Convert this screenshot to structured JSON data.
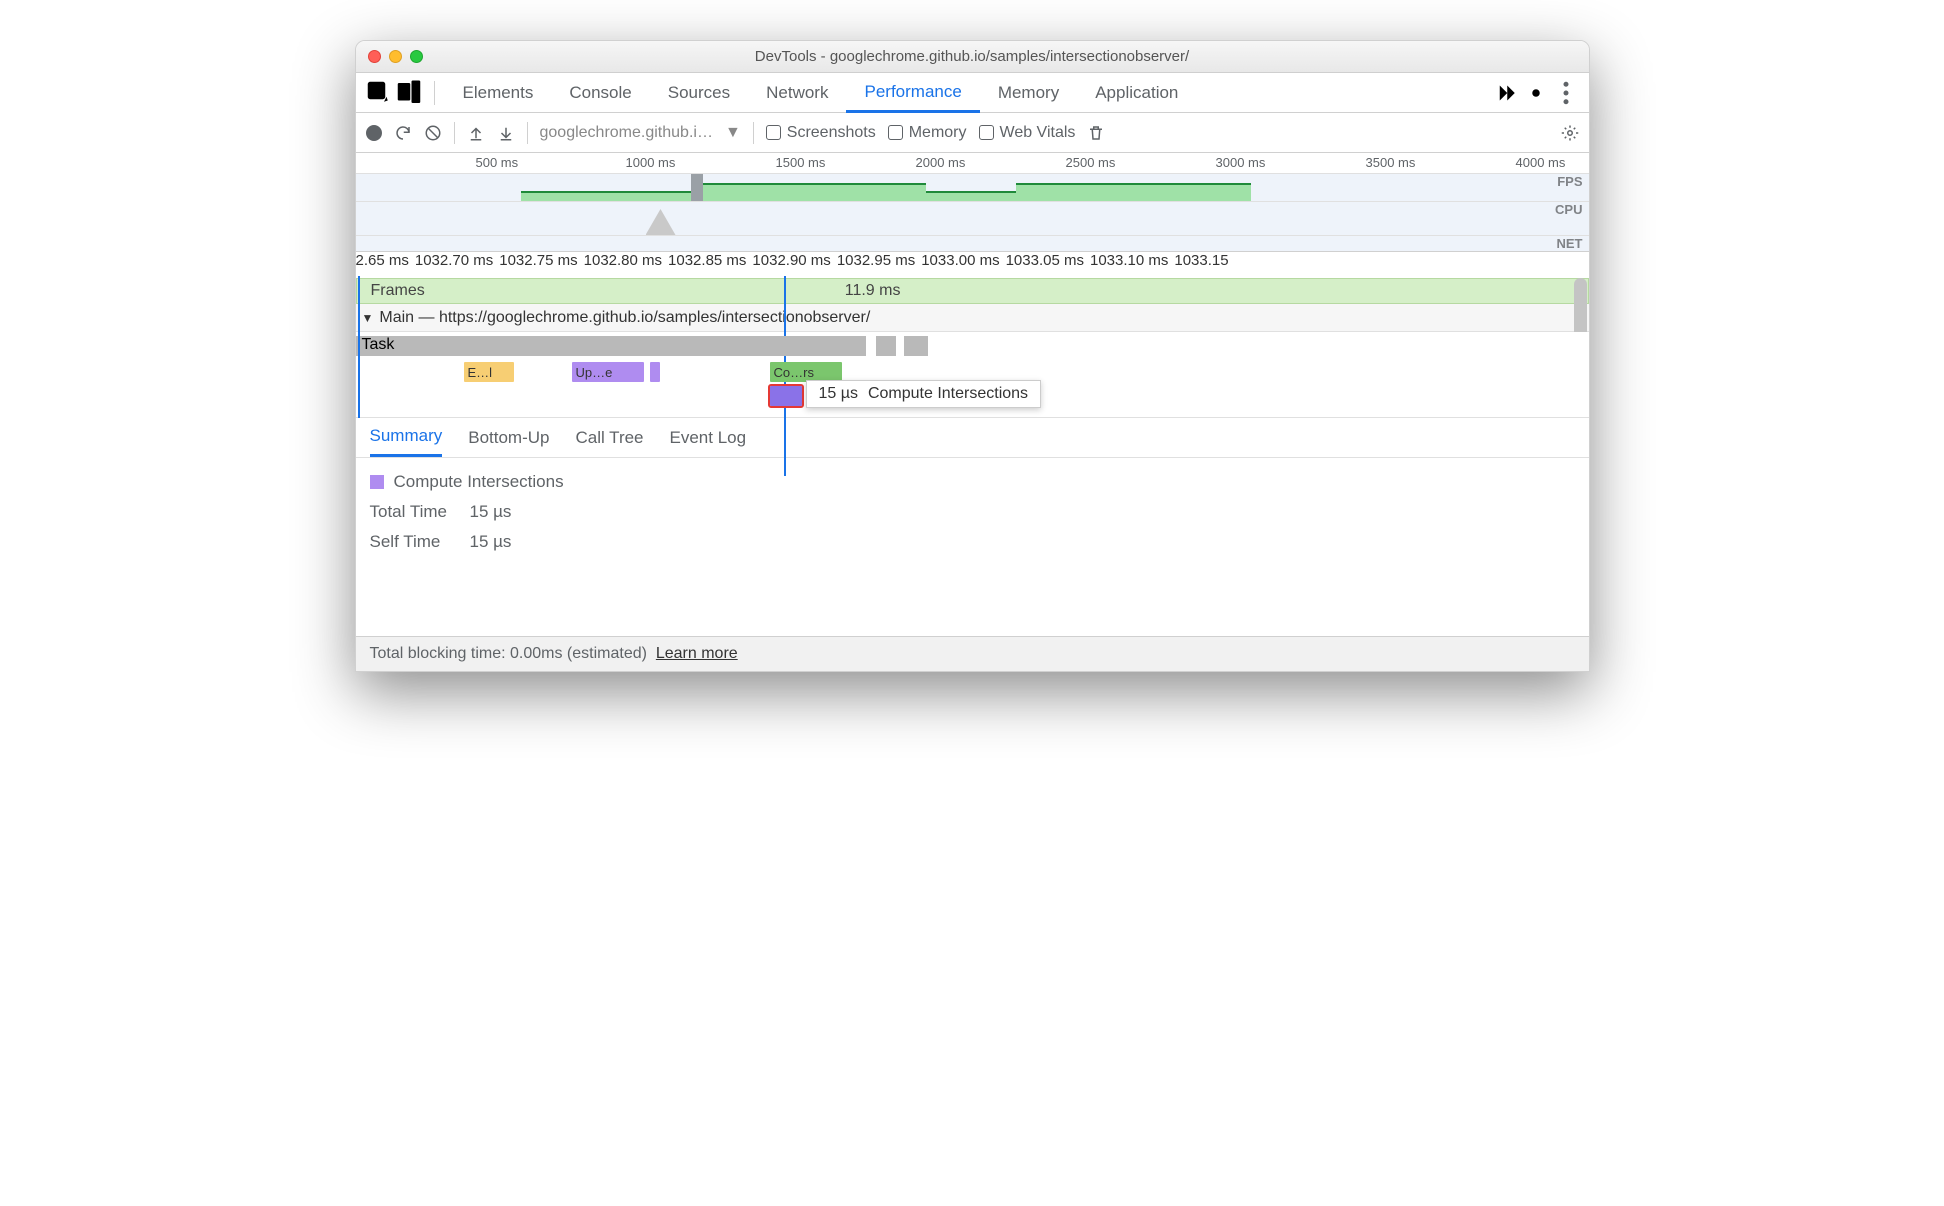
{
  "window": {
    "title": "DevTools - googlechrome.github.io/samples/intersectionobserver/"
  },
  "tabs": [
    "Elements",
    "Console",
    "Sources",
    "Network",
    "Performance",
    "Memory",
    "Application"
  ],
  "active_tab": "Performance",
  "toolbar": {
    "source": "googlechrome.github.i…",
    "checks": {
      "screenshots": "Screenshots",
      "memory": "Memory",
      "webvitals": "Web Vitals"
    }
  },
  "overview": {
    "ticks": [
      "500 ms",
      "1000 ms",
      "1500 ms",
      "2000 ms",
      "2500 ms",
      "3000 ms",
      "3500 ms",
      "4000 ms"
    ],
    "lanes": {
      "fps": "FPS",
      "cpu": "CPU",
      "net": "NET"
    }
  },
  "zoom_ticks": [
    "2.65 ms",
    "1032.70 ms",
    "1032.75 ms",
    "1032.80 ms",
    "1032.85 ms",
    "1032.90 ms",
    "1032.95 ms",
    "1033.00 ms",
    "1033.05 ms",
    "1033.10 ms",
    "1033.15"
  ],
  "frames": {
    "label": "Frames",
    "value": "11.9 ms"
  },
  "main": {
    "label": "Main — https://googlechrome.github.io/samples/intersectionobserver/"
  },
  "task": "Task",
  "events": {
    "e1": "E…l",
    "e2": "Up…e",
    "e3": "Co…rs"
  },
  "tooltip": {
    "time": "15 µs",
    "name": "Compute Intersections"
  },
  "detail_tabs": [
    "Summary",
    "Bottom-Up",
    "Call Tree",
    "Event Log"
  ],
  "summary": {
    "title": "Compute Intersections",
    "rows": [
      {
        "k": "Total Time",
        "v": "15 µs"
      },
      {
        "k": "Self Time",
        "v": "15 µs"
      }
    ]
  },
  "footer": {
    "text": "Total blocking time: 0.00ms (estimated)",
    "link": "Learn more"
  }
}
